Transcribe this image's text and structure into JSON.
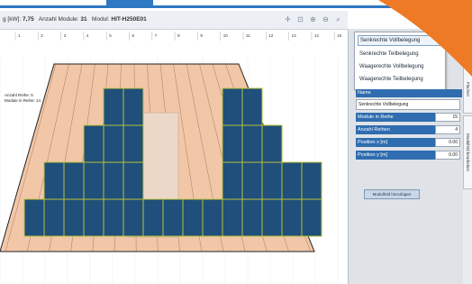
{
  "toolbar": {
    "power_label": "g [kW]:",
    "power_value": "7,75",
    "modules_label": "Anzahl Module:",
    "modules_value": "31",
    "module_label": "Modul:",
    "module_value": "HIT-H250E01"
  },
  "ruler": {
    "ticks": [
      "1",
      "2",
      "3",
      "4",
      "5",
      "6",
      "7",
      "8",
      "9",
      "10",
      "11",
      "12",
      "13",
      "14",
      "15"
    ]
  },
  "canvas": {
    "row_label_1": "Anzahl Reihe: 5",
    "row_label_2": "Module in Reihe: 14"
  },
  "roof": {
    "colors": {
      "roof": "#f2c7a8",
      "module": "#1f4f7a",
      "module_border": "#b9c23a",
      "window": "#ecd8c8",
      "batten": "#6b4a36"
    }
  },
  "menu": {
    "items": [
      "Senkrechte Vollbelegung",
      "Senkrechte Teilbelegung",
      "Waagerechte Vollbelegung",
      "Waagerechte Teilbelegung"
    ]
  },
  "properties": {
    "name_label": "Name",
    "name_value": "Senkrechte Vollbelegung",
    "rows": [
      {
        "label": "Module in Reihe",
        "value": "15"
      },
      {
        "label": "Anzahl Reihen",
        "value": "4"
      },
      {
        "label": "Position x [m]",
        "value": "0.00"
      },
      {
        "label": "Position y [m]",
        "value": "0.00"
      }
    ],
    "add_button": "Modulfeld hinzufügen"
  },
  "side_tabs": [
    "Flächen",
    "Modulfeld bearbeiten"
  ]
}
